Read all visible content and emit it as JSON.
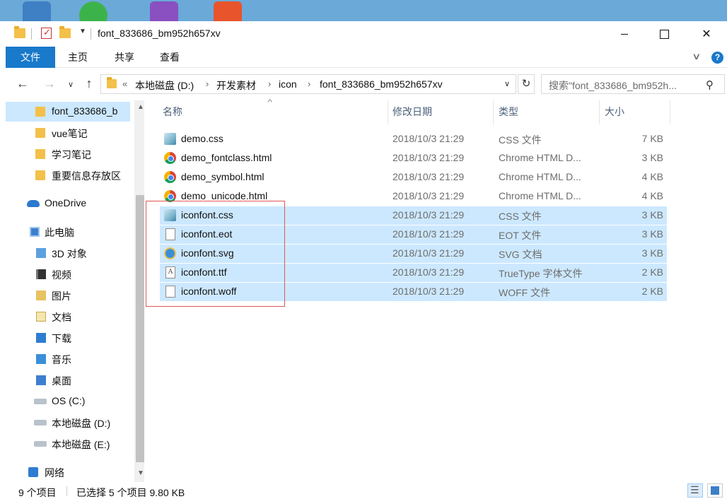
{
  "window": {
    "title": "font_833686_bm952h657xv"
  },
  "ribbon": {
    "tabs": [
      "文件",
      "主页",
      "共享",
      "查看"
    ],
    "help": "?"
  },
  "address_bar": {
    "overflow": "«",
    "segments": [
      "本地磁盘 (D:)",
      "开发素材",
      "icon",
      "font_833686_bm952h657xv"
    ],
    "separator": "›"
  },
  "search": {
    "placeholder": "搜索\"font_833686_bm952h..."
  },
  "nav_pane": {
    "items": [
      {
        "label": "font_833686_b",
        "icon": "folder-icon",
        "selected": true
      },
      {
        "label": "vue笔记",
        "icon": "folder-icon"
      },
      {
        "label": "学习笔记",
        "icon": "folder-icon"
      },
      {
        "label": "重要信息存放区",
        "icon": "folder-icon"
      },
      {
        "label": "OneDrive",
        "icon": "cloud-icon"
      },
      {
        "label": "此电脑",
        "icon": "computer-icon"
      },
      {
        "label": "3D 对象",
        "icon": "cube-icon"
      },
      {
        "label": "视频",
        "icon": "video-icon"
      },
      {
        "label": "图片",
        "icon": "picture-icon"
      },
      {
        "label": "文档",
        "icon": "document-icon"
      },
      {
        "label": "下载",
        "icon": "download-icon"
      },
      {
        "label": "音乐",
        "icon": "music-icon"
      },
      {
        "label": "桌面",
        "icon": "desktop-icon"
      },
      {
        "label": "OS (C:)",
        "icon": "drive-icon"
      },
      {
        "label": "本地磁盘 (D:)",
        "icon": "drive-icon"
      },
      {
        "label": "本地磁盘 (E:)",
        "icon": "drive-icon"
      },
      {
        "label": "网络",
        "icon": "network-icon"
      }
    ]
  },
  "file_list": {
    "columns": [
      "名称",
      "修改日期",
      "类型",
      "大小"
    ],
    "sort_column": "名称",
    "files": [
      {
        "name": "demo.css",
        "date": "2018/10/3 21:29",
        "type": "CSS 文件",
        "size": "7 KB",
        "icon": "css-file-icon",
        "selected": false
      },
      {
        "name": "demo_fontclass.html",
        "date": "2018/10/3 21:29",
        "type": "Chrome HTML D...",
        "size": "3 KB",
        "icon": "chrome-icon",
        "selected": false
      },
      {
        "name": "demo_symbol.html",
        "date": "2018/10/3 21:29",
        "type": "Chrome HTML D...",
        "size": "4 KB",
        "icon": "chrome-icon",
        "selected": false
      },
      {
        "name": "demo_unicode.html",
        "date": "2018/10/3 21:29",
        "type": "Chrome HTML D...",
        "size": "4 KB",
        "icon": "chrome-icon",
        "selected": false
      },
      {
        "name": "iconfont.css",
        "date": "2018/10/3 21:29",
        "type": "CSS 文件",
        "size": "3 KB",
        "icon": "css-file-icon",
        "selected": true
      },
      {
        "name": "iconfont.eot",
        "date": "2018/10/3 21:29",
        "type": "EOT 文件",
        "size": "3 KB",
        "icon": "blank-file-icon",
        "selected": true
      },
      {
        "name": "iconfont.svg",
        "date": "2018/10/3 21:29",
        "type": "SVG 文档",
        "size": "3 KB",
        "icon": "svg-file-icon",
        "selected": true
      },
      {
        "name": "iconfont.ttf",
        "date": "2018/10/3 21:29",
        "type": "TrueType 字体文件",
        "size": "2 KB",
        "icon": "font-file-icon",
        "selected": true
      },
      {
        "name": "iconfont.woff",
        "date": "2018/10/3 21:29",
        "type": "WOFF 文件",
        "size": "2 KB",
        "icon": "blank-file-icon",
        "selected": true
      }
    ]
  },
  "status": {
    "item_count": "9 个项目",
    "selection": "已选择 5 个项目  9.80 KB"
  },
  "colors": {
    "accent": "#1979ca",
    "selection": "#cce8ff",
    "highlight_box": "#e05555"
  }
}
